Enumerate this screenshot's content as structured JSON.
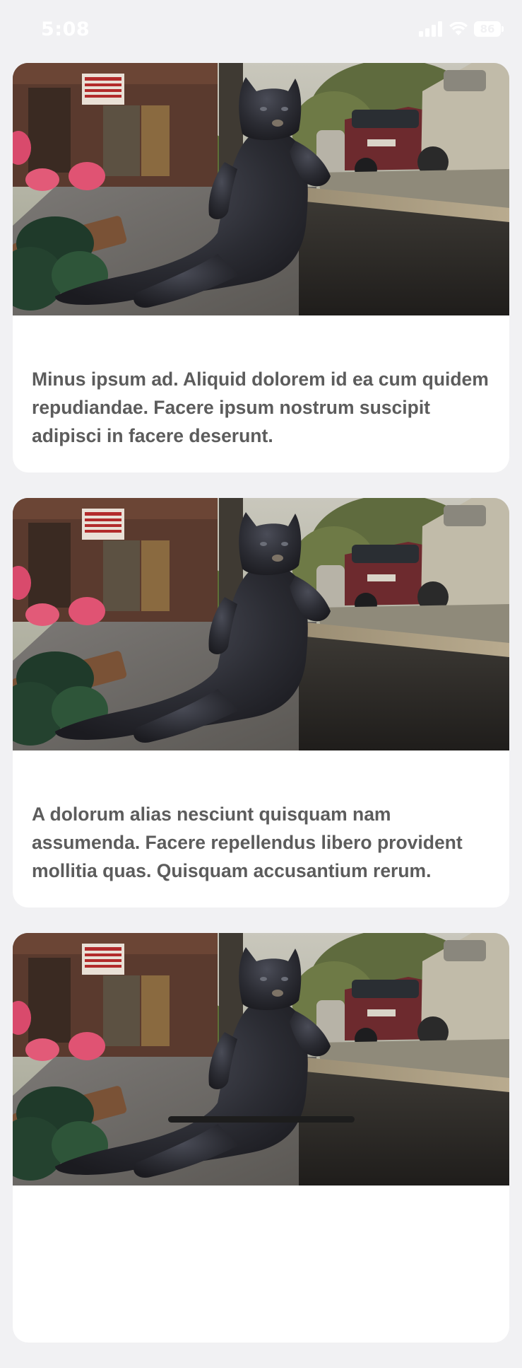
{
  "status_bar": {
    "time": "5:08",
    "battery": "86"
  },
  "feed": {
    "items": [
      {
        "text": "Minus ipsum ad. Aliquid dolorem id ea cum quidem repudiandae. Facere ipsum nostrum suscipit adipisci in facere deserunt."
      },
      {
        "text": "A dolorum alias nesciunt quisquam nam assumenda. Facere repellendus libero provident mollitia quas. Quisquam accusantium rerum."
      },
      {
        "text": ""
      }
    ]
  }
}
